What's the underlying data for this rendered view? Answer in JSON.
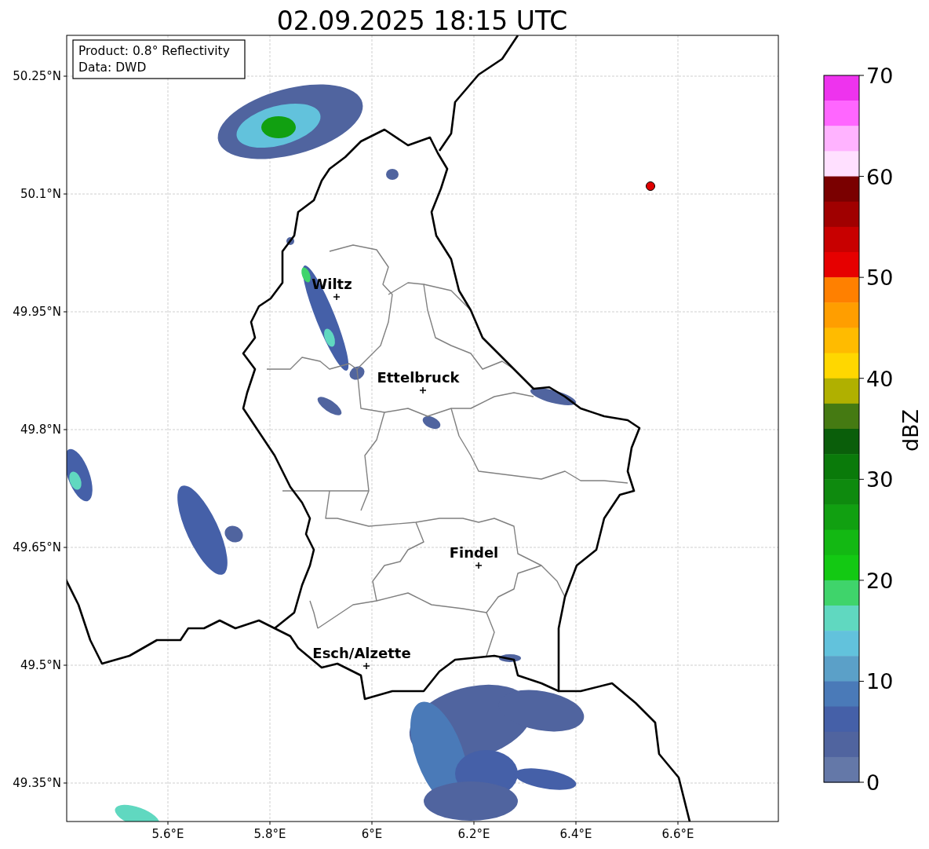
{
  "title": "02.09.2025 18:15 UTC",
  "info_box": {
    "lines": [
      "Product: 0.8° Reflectivity",
      "Data: DWD"
    ]
  },
  "map": {
    "yticks": [
      "50.25°N",
      "50.1°N",
      "49.95°N",
      "49.8°N",
      "49.65°N",
      "49.5°N",
      "49.35°N"
    ],
    "xticks": [
      "5.6°E",
      "5.8°E",
      "6°E",
      "6.2°E",
      "6.4°E",
      "6.6°E"
    ],
    "cities": [
      {
        "name": "Wiltz"
      },
      {
        "name": "Ettelbruck"
      },
      {
        "name": "Findel"
      },
      {
        "name": "Esch/Alzette"
      }
    ]
  },
  "colorbar": {
    "label": "dBZ",
    "ticks": [
      "70",
      "60",
      "50",
      "40",
      "30",
      "20",
      "10",
      "0"
    ],
    "bins": [
      {
        "color": "#ee33ee"
      },
      {
        "color": "#ff66ff"
      },
      {
        "color": "#ffb3ff"
      },
      {
        "color": "#ffe0ff"
      },
      {
        "color": "#7a0000"
      },
      {
        "color": "#a00000"
      },
      {
        "color": "#c80000"
      },
      {
        "color": "#e60000"
      },
      {
        "color": "#ff8000"
      },
      {
        "color": "#ff9e00"
      },
      {
        "color": "#ffbb00"
      },
      {
        "color": "#ffd700"
      },
      {
        "color": "#b0b000"
      },
      {
        "color": "#457a12"
      },
      {
        "color": "#0a5e0a"
      },
      {
        "color": "#0a7a0a"
      },
      {
        "color": "#0e8a0e"
      },
      {
        "color": "#11a011"
      },
      {
        "color": "#13b813"
      },
      {
        "color": "#13c913"
      },
      {
        "color": "#3fd46b"
      },
      {
        "color": "#60d8c0"
      },
      {
        "color": "#62c2dc"
      },
      {
        "color": "#5ba0c8"
      },
      {
        "color": "#4a7ab8"
      },
      {
        "color": "#4560a8"
      },
      {
        "color": "#50649f"
      },
      {
        "color": "#6478a8"
      }
    ]
  }
}
